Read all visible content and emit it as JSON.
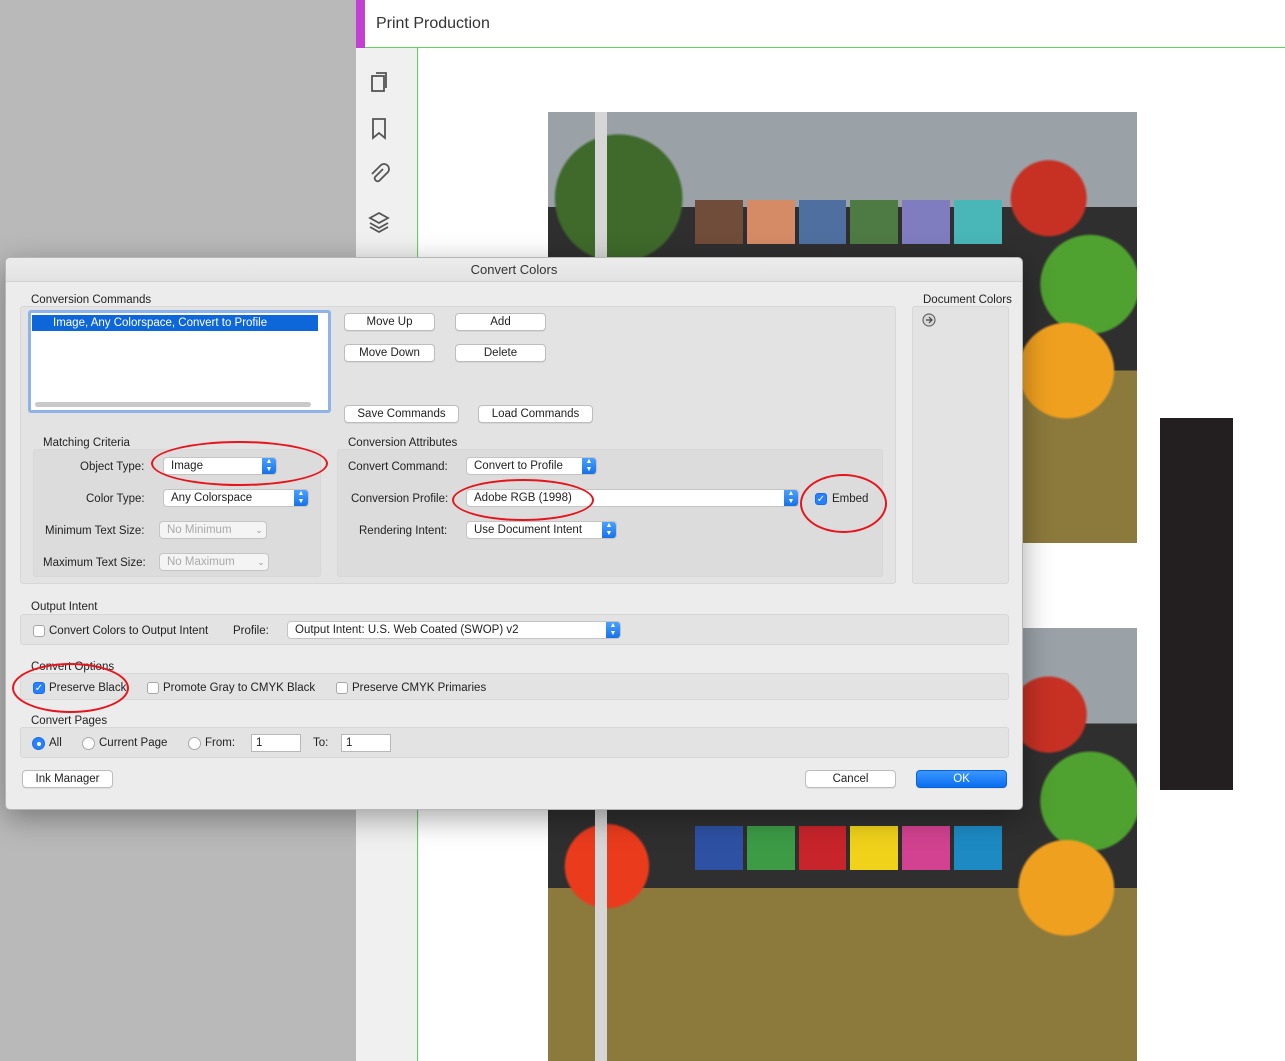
{
  "app": {
    "panel_title": "Print Production"
  },
  "tools": [
    "pages-icon",
    "bookmark-icon",
    "attachment-icon",
    "layers-icon"
  ],
  "dialog": {
    "title": "Convert Colors",
    "conversion_commands": {
      "label": "Conversion Commands",
      "items": [
        "Image, Any Colorspace, Convert to Profile"
      ],
      "buttons": {
        "move_up": "Move Up",
        "add": "Add",
        "move_down": "Move Down",
        "delete": "Delete",
        "save": "Save Commands",
        "load": "Load Commands"
      }
    },
    "document_colors": {
      "label": "Document Colors"
    },
    "matching_criteria": {
      "label": "Matching Criteria",
      "object_type_label": "Object Type:",
      "object_type": "Image",
      "color_type_label": "Color Type:",
      "color_type": "Any Colorspace",
      "min_text_label": "Minimum Text Size:",
      "min_text": "No Minimum",
      "max_text_label": "Maximum Text Size:",
      "max_text": "No Maximum"
    },
    "conversion_attributes": {
      "label": "Conversion Attributes",
      "command_label": "Convert Command:",
      "command": "Convert to Profile",
      "profile_label": "Conversion Profile:",
      "profile": "Adobe RGB (1998)",
      "embed_label": "Embed",
      "embed_checked": true,
      "intent_label": "Rendering Intent:",
      "intent": "Use Document Intent"
    },
    "output_intent": {
      "label": "Output Intent",
      "convert_label": "Convert Colors to Output Intent",
      "convert_checked": false,
      "profile_label": "Profile:",
      "profile": "Output Intent: U.S. Web Coated (SWOP) v2"
    },
    "convert_options": {
      "label": "Convert Options",
      "preserve_black": "Preserve Black",
      "preserve_black_checked": true,
      "promote_gray": "Promote Gray to CMYK Black",
      "promote_gray_checked": false,
      "preserve_cmyk": "Preserve CMYK Primaries",
      "preserve_cmyk_checked": false
    },
    "convert_pages": {
      "label": "Convert Pages",
      "all": "All",
      "current": "Current Page",
      "from": "From:",
      "to": "To:",
      "from_value": "1",
      "to_value": "1",
      "selected": "All"
    },
    "footer": {
      "ink_manager": "Ink Manager",
      "cancel": "Cancel",
      "ok": "OK"
    }
  },
  "colors": {
    "accent": "#c23fd2",
    "selection": "#0e67d8",
    "annotation": "#e8141b",
    "page_border": "#5fd35f"
  }
}
